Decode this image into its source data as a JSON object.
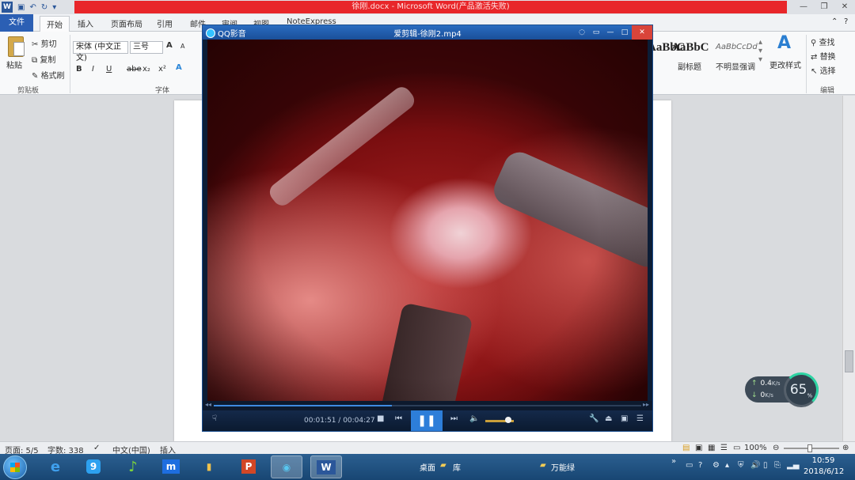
{
  "word": {
    "title": "徐刚.docx - Microsoft Word(产品激活失败)",
    "tabs": [
      "文件",
      "开始",
      "插入",
      "页面布局",
      "引用",
      "邮件",
      "审阅",
      "视图",
      "NoteExpress"
    ],
    "clipboard": {
      "paste": "粘贴",
      "cut": "剪切",
      "copy": "复制",
      "format_painter": "格式刷",
      "group": "剪贴板"
    },
    "font": {
      "name": "宋体 (中文正文)",
      "size": "三号",
      "group": "字体",
      "bold": "B",
      "italic": "I",
      "underline": "U",
      "strike": "abe",
      "subscript": "x₂",
      "superscript": "x²",
      "grow": "A",
      "shrink": "A"
    },
    "styles": {
      "preview_1": "AaBbC",
      "preview_2": "AaBbC",
      "preview_3": "AaBbCcDd",
      "label_2": "副标题",
      "label_3": "不明显强调",
      "change": "更改样式"
    },
    "editing": {
      "find": "查找",
      "replace": "替换",
      "select": "选择",
      "group": "编辑"
    },
    "status": {
      "page": "页面: 5/5",
      "words": "字数: 338",
      "lang": "中文(中国)",
      "mode": "插入",
      "zoom": "100%"
    }
  },
  "player": {
    "app_name": "QQ影音",
    "file_name": "爱剪辑-徐刚2.mp4",
    "time_current": "00:01:51",
    "time_total": "00:04:27",
    "progress": 0.416,
    "volume": 0.8
  },
  "netspeed": {
    "up": "0.4",
    "down": "0",
    "unit": "K/s",
    "percent": "65",
    "percent_unit": "%"
  },
  "taskbar": {
    "desktop_label": "桌面",
    "library_label": "库",
    "tray_app": "万能绿",
    "time": "10:59",
    "date": "2018/6/12"
  },
  "colors": {
    "word_blue": "#2b579a",
    "player_bg": "#0c1d36",
    "progress": "#3e8ae0",
    "title_red": "#e8262a"
  }
}
